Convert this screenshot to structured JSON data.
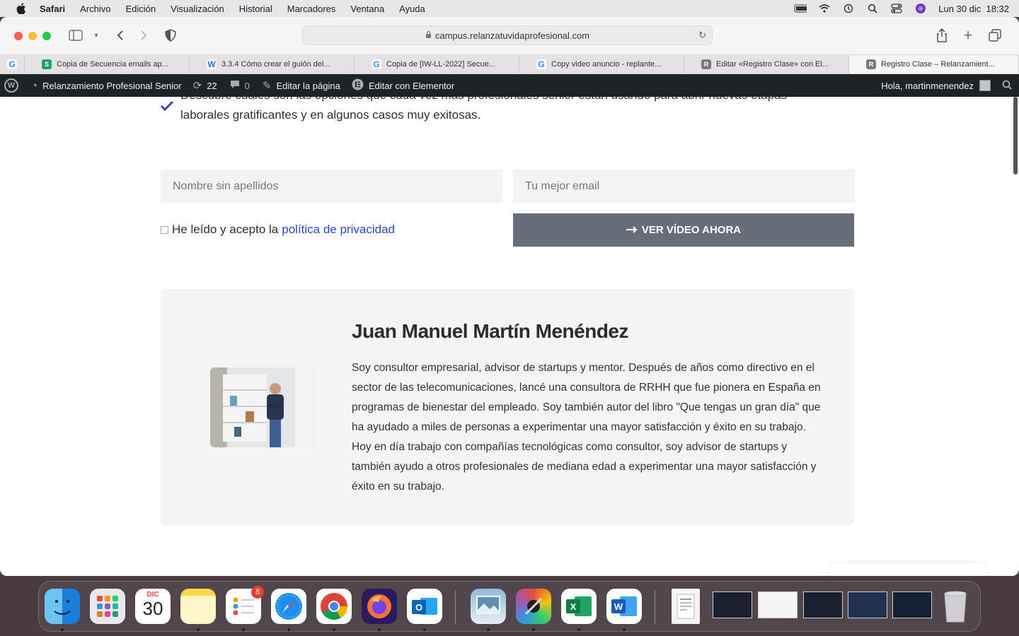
{
  "menubar": {
    "apple": "",
    "items": [
      "Safari",
      "Archivo",
      "Edición",
      "Visualización",
      "Historial",
      "Marcadores",
      "Ventana",
      "Ayuda"
    ],
    "clock": "Lun 30 dic  18:32"
  },
  "browser": {
    "url": "campus.relanzatuvidaprofesional.com",
    "tabs": [
      "Copia de Secuencia emails ap...",
      "3.3.4 Cómo crear el guión del...",
      "Copia de [IW-LL-2022] Secue...",
      "Copy video anuncio - replante...",
      "Editar «Registro Clase» con El...",
      "Registro Clase – Relanzamient..."
    ],
    "tab_favicons": [
      "S",
      "W",
      "G",
      "G",
      "R",
      "R"
    ]
  },
  "wpbar": {
    "site_name": "Relanzamiento Profesional Senior",
    "updates": "22",
    "comments": "0",
    "edit_page": "Editar la página",
    "edit_elementor": "Editar con Elementor",
    "greeting": "Hola, martinmenendez"
  },
  "content": {
    "bullet": "Descubre cuáles son las opciones que cada vez más profesionales senior están usando para abrir nuevas etapas laborales gratificantes y en algunos casos muy exitosas.",
    "name_placeholder": "Nombre sin apellidos",
    "email_placeholder": "Tu mejor email",
    "consent_text": "He leído y acepto la",
    "privacy_link": "política de privacidad",
    "cta_label": "VER VÍDEO AHORA",
    "bio_name": "Juan Manuel Martín Menéndez",
    "bio_text": "Soy consultor empresarial, advisor de startups y mentor. Después de años como directivo en el sector de las telecomunicaciones, lancé una consultora de RRHH que fue pionera en España en programas de bienestar del empleado. Soy también autor del libro \"Que tengas un gran día\" que ha ayudado a miles de personas a experimentar una mayor satisfacción y éxito en su trabajo. Hoy en día trabajo con compañías tecnológicas como consultor, soy advisor de startups y también ayudo a otros profesionales de mediana edad a experimentar una mayor satisfacción y éxito en su trabajo."
  },
  "dock": {
    "calendar_month": "DIC",
    "calendar_day": "30",
    "reminders_badge": "8"
  },
  "colors": {
    "accent_blue": "#2e4bb5",
    "cta_bg": "#676d79",
    "wp_bar": "#1d2327"
  }
}
